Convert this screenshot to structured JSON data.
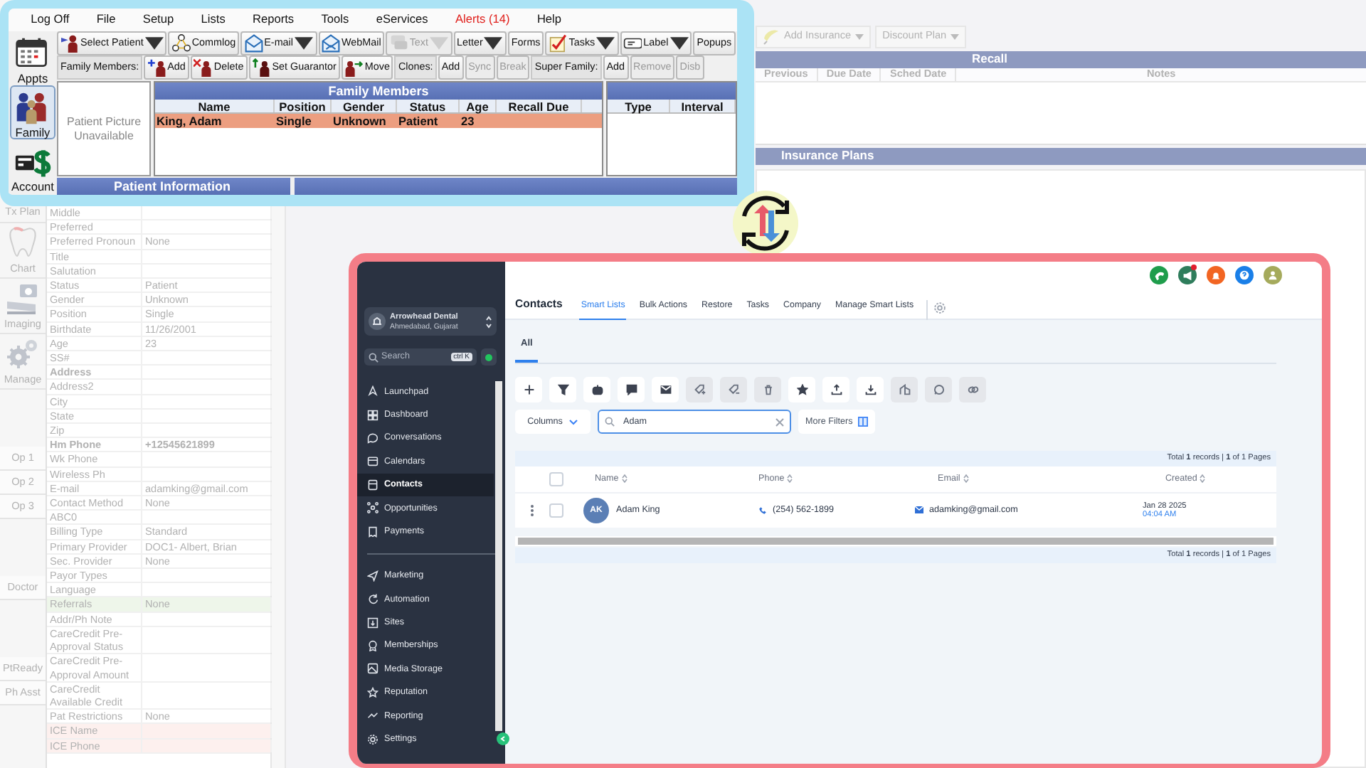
{
  "background": {
    "modules": [
      {
        "label": "Tx Plan",
        "kind": "label",
        "gap_before": false
      },
      {
        "label": "Chart",
        "kind": "module",
        "gap_before": false
      },
      {
        "label": "Imaging",
        "kind": "module",
        "gap_before": false
      },
      {
        "label": "Manage",
        "kind": "module",
        "gap_before": false
      },
      {
        "label": "Op 1",
        "kind": "button",
        "gap_before": true
      },
      {
        "label": "Op 2",
        "kind": "button",
        "gap_before": false
      },
      {
        "label": "Op 3",
        "kind": "button",
        "gap_before": false
      },
      {
        "label": "Doctor",
        "kind": "button",
        "gap_before": true
      },
      {
        "label": "PtReady",
        "kind": "button",
        "gap_before": true
      },
      {
        "label": "Ph Asst",
        "kind": "button",
        "gap_before": false
      }
    ],
    "patient_fields": [
      {
        "label": "Middle",
        "bold": false
      },
      {
        "label": "Preferred",
        "bold": false
      },
      {
        "label": "Preferred Pronoun",
        "value": "None",
        "bold": false
      },
      {
        "label": "Title",
        "bold": false
      },
      {
        "label": "Salutation",
        "bold": false
      },
      {
        "label": "Status",
        "value": "Patient",
        "bold": false
      },
      {
        "label": "Gender",
        "value": "Unknown",
        "bold": false
      },
      {
        "label": "Position",
        "value": "Single",
        "bold": false
      },
      {
        "label": "Birthdate",
        "value": "11/26/2001",
        "bold": false
      },
      {
        "label": "Age",
        "value": "23",
        "bold": false
      },
      {
        "label": "SS#",
        "bold": false
      },
      {
        "label": "Address",
        "bold": true
      },
      {
        "label": "Address2",
        "bold": false
      },
      {
        "label": "City",
        "bold": false
      },
      {
        "label": "State",
        "bold": false
      },
      {
        "label": "Zip",
        "bold": false
      },
      {
        "label": "Hm Phone",
        "value": "+12545621899",
        "bold": true
      },
      {
        "label": "Wk Phone",
        "bold": false
      },
      {
        "label": "Wireless Ph",
        "bold": false
      },
      {
        "label": "E-mail",
        "value": "adamking@gmail.com",
        "bold": false
      },
      {
        "label": "Contact Method",
        "value": "None",
        "bold": false
      },
      {
        "label": "ABC0",
        "bold": false
      },
      {
        "label": "Billing Type",
        "value": "Standard",
        "bold": false
      },
      {
        "label": "Primary Provider",
        "value": "DOC1- Albert, Brian",
        "bold": false
      },
      {
        "label": "Sec. Provider",
        "value": "None",
        "bold": false
      },
      {
        "label": "Payor Types",
        "bold": false
      },
      {
        "label": "Language",
        "bold": false
      },
      {
        "label": "Referrals",
        "value": "None",
        "bold": false,
        "color": "#eef6ea"
      },
      {
        "label": "Addr/Ph Note",
        "bold": false
      },
      {
        "label": "CareCredit Pre-Approval Status",
        "bold": false
      },
      {
        "label": "CareCredit Pre-Approval Amount",
        "bold": false
      },
      {
        "label": "CareCredit Available Credit",
        "bold": false
      },
      {
        "label": "Pat Restrictions",
        "value": "None",
        "bold": false
      },
      {
        "label": "ICE Name",
        "bold": false,
        "color": "#fdf0ee"
      },
      {
        "label": "ICE Phone",
        "bold": false,
        "color": "#fdf0ee"
      }
    ],
    "toolbar": [
      {
        "label": "Add Insurance",
        "kind": "icon",
        "dropdown": true
      },
      {
        "label": "Discount Plan",
        "kind": "text",
        "dropdown": true
      }
    ],
    "recall": {
      "title": "Recall",
      "columns": [
        "Previous",
        "Due Date",
        "Sched Date",
        "Notes"
      ]
    },
    "insurance": {
      "title": "Insurance Plans"
    }
  },
  "open_dental": {
    "menu": [
      {
        "label": "Log Off",
        "alert": false
      },
      {
        "label": "File",
        "alert": false
      },
      {
        "label": "Setup",
        "alert": false
      },
      {
        "label": "Lists",
        "alert": false
      },
      {
        "label": "Reports",
        "alert": false
      },
      {
        "label": "Tools",
        "alert": false
      },
      {
        "label": "eServices",
        "alert": false
      },
      {
        "label": "Alerts (14)",
        "alert": true
      },
      {
        "label": "Help",
        "alert": false
      }
    ],
    "modules": [
      {
        "label": "Appts",
        "selected": false
      },
      {
        "label": "Family",
        "selected": true
      },
      {
        "label": "Account",
        "selected": false
      }
    ],
    "toolbar": [
      {
        "label": "Select Patient",
        "kind": "icon",
        "dropdown": true,
        "disabled": false
      },
      {
        "label": "Commlog",
        "kind": "icon",
        "dropdown": false,
        "disabled": false
      },
      {
        "label": "E-mail",
        "kind": "icon",
        "dropdown": true,
        "disabled": false
      },
      {
        "label": "WebMail",
        "kind": "icon",
        "dropdown": false,
        "disabled": false
      },
      {
        "label": "Text",
        "kind": "icon",
        "dropdown": true,
        "disabled": true
      },
      {
        "label": "Letter",
        "kind": "text",
        "dropdown": true,
        "disabled": false
      },
      {
        "label": "Forms",
        "kind": "text",
        "dropdown": false,
        "disabled": false
      },
      {
        "label": "Tasks",
        "kind": "icon",
        "dropdown": true,
        "disabled": false
      },
      {
        "label": "Label",
        "kind": "icon",
        "dropdown": true,
        "disabled": false
      },
      {
        "label": "Popups",
        "kind": "text",
        "dropdown": false,
        "disabled": false
      }
    ],
    "family_bar": [
      {
        "label": "Family Members:",
        "kind": "label"
      },
      {
        "label": "Add",
        "kind": "icon",
        "disabled": false
      },
      {
        "label": "Delete",
        "kind": "icon",
        "disabled": false
      },
      {
        "label": "Set Guarantor",
        "kind": "icon",
        "disabled": false
      },
      {
        "label": "Move",
        "kind": "icon",
        "disabled": false
      },
      {
        "label": "Clones:",
        "kind": "label"
      },
      {
        "label": "Add",
        "kind": "text",
        "disabled": false
      },
      {
        "label": "Sync",
        "kind": "text",
        "disabled": true
      },
      {
        "label": "Break",
        "kind": "text",
        "disabled": true
      },
      {
        "label": "Super Family:",
        "kind": "label"
      },
      {
        "label": "Add",
        "kind": "text",
        "disabled": false
      },
      {
        "label": "Remove",
        "kind": "text",
        "disabled": true
      },
      {
        "label": "Disb",
        "kind": "text",
        "disabled": true
      }
    ],
    "picture_text": "Patient Picture Unavailable",
    "family_grid": {
      "title": "Family Members",
      "columns": [
        "Name",
        "Position",
        "Gender",
        "Status",
        "Age",
        "Recall Due"
      ],
      "rows": [
        {
          "cells": [
            "King, Adam",
            "Single",
            "Unknown",
            "Patient",
            "23"
          ],
          "selected": true
        }
      ]
    },
    "recall_grid": {
      "columns": [
        "Type",
        "Interval"
      ]
    },
    "patient_info_title": "Patient Information"
  },
  "crm": {
    "account": {
      "name": "Arrowhead Dental",
      "location": "Ahmedabad, Gujarat"
    },
    "search": {
      "placeholder": "Search",
      "shortcut": "ctrl K"
    },
    "nav_main": [
      {
        "label": "Launchpad",
        "selected": false
      },
      {
        "label": "Dashboard",
        "selected": false
      },
      {
        "label": "Conversations",
        "selected": false
      },
      {
        "label": "Calendars",
        "selected": false
      },
      {
        "label": "Contacts",
        "selected": true
      },
      {
        "label": "Opportunities",
        "selected": false
      },
      {
        "label": "Payments",
        "selected": false
      }
    ],
    "nav_more": [
      {
        "label": "Marketing",
        "selected": false
      },
      {
        "label": "Automation",
        "selected": false
      },
      {
        "label": "Sites",
        "selected": false
      },
      {
        "label": "Memberships",
        "selected": false
      },
      {
        "label": "Media Storage",
        "selected": false
      },
      {
        "label": "Reputation",
        "selected": false
      },
      {
        "label": "Reporting",
        "selected": false
      },
      {
        "label": "Settings",
        "selected": false
      }
    ],
    "header_icons": [
      {
        "color": "#1f9d4c",
        "badge": false
      },
      {
        "color": "#2f7d5c",
        "badge": true
      },
      {
        "color": "#f26522",
        "badge": false
      },
      {
        "color": "#1a7fe8",
        "badge": false
      },
      {
        "color": "#a5aa5c",
        "badge": false
      }
    ],
    "title": "Contacts",
    "tabs": [
      {
        "label": "Smart Lists",
        "selected": true
      },
      {
        "label": "Bulk Actions",
        "selected": false
      },
      {
        "label": "Restore",
        "selected": false
      },
      {
        "label": "Tasks",
        "selected": false
      },
      {
        "label": "Company",
        "selected": false
      },
      {
        "label": "Manage Smart Lists",
        "selected": false
      }
    ],
    "lists": [
      {
        "label": "All",
        "selected": true
      }
    ],
    "icon_buttons": [
      {
        "disabled": false
      },
      {
        "disabled": false
      },
      {
        "disabled": false
      },
      {
        "disabled": false
      },
      {
        "disabled": false
      },
      {
        "disabled": true
      },
      {
        "disabled": true
      },
      {
        "disabled": true
      },
      {
        "disabled": false
      },
      {
        "disabled": false
      },
      {
        "disabled": false
      },
      {
        "disabled": true
      },
      {
        "disabled": true
      },
      {
        "disabled": true
      }
    ],
    "columns_button": "Columns",
    "filter": {
      "value": "Adam"
    },
    "more_filters": "More Filters",
    "pagination_top": "Total **1** records | **1** of 1 Pages",
    "table": {
      "header_checked": false,
      "columns": [
        "Name",
        "Phone",
        "Email",
        "Created"
      ],
      "rows": [
        {
          "checked": false,
          "initials": "AK",
          "name": "Adam King",
          "phone": "(254) 562-1899",
          "email": "adamking@gmail.com",
          "created_date": "Jan 28 2025",
          "created_time": "04:04 AM"
        }
      ]
    },
    "pagination_bottom": "Total **1** records | **1** of 1 Pages"
  }
}
